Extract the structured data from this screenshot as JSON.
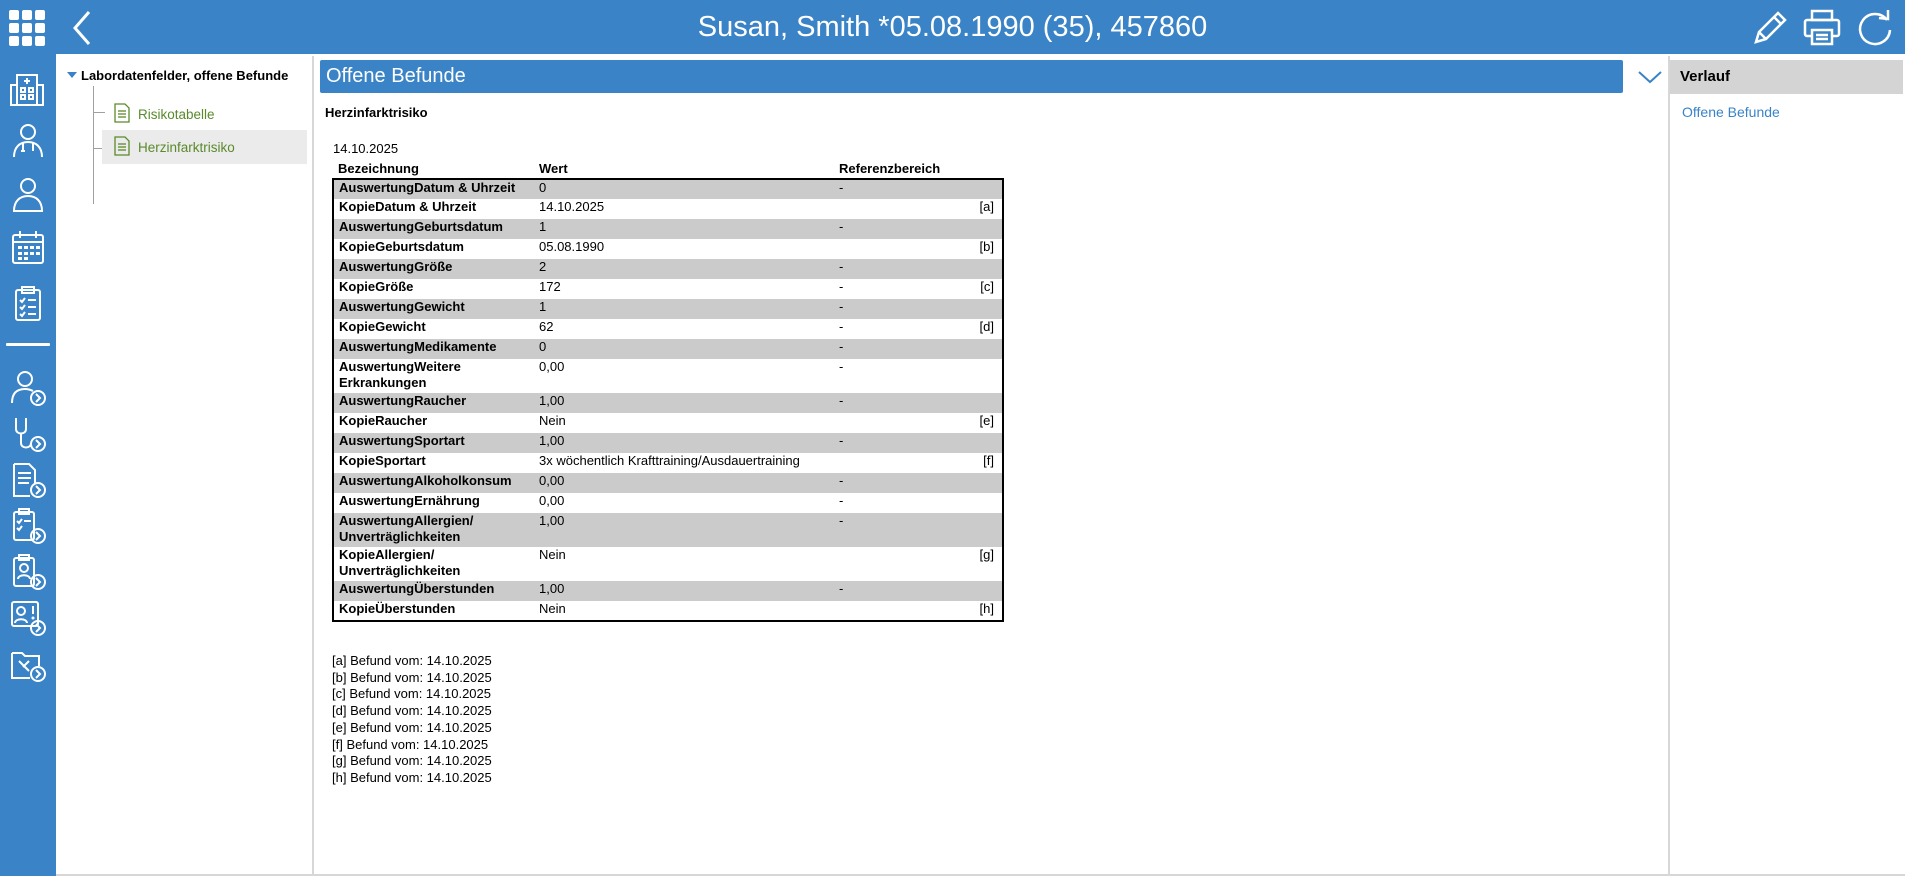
{
  "header": {
    "title": "Susan, Smith *05.08.1990 (35), 457860"
  },
  "icons": {
    "apps": "grid-icon",
    "back": "chevron-left-icon",
    "edit": "pencil-icon",
    "print": "printer-icon",
    "refresh": "refresh-icon"
  },
  "tree": {
    "root_label": "Labordatenfelder, offene Befunde",
    "items": [
      {
        "label": "Risikotabelle"
      },
      {
        "label": "Herzinfarktrisiko"
      }
    ]
  },
  "main": {
    "section_title": "Offene Befunde",
    "report_title": "Herzinfarktrisiko",
    "date": "14.10.2025",
    "columns": [
      "Bezeichnung",
      "Wert",
      "Referenzbereich"
    ],
    "rows": [
      {
        "name": "AuswertungDatum & Uhrzeit",
        "value": "0",
        "ref": "-",
        "note": ""
      },
      {
        "name": "KopieDatum & Uhrzeit",
        "value": "14.10.2025",
        "ref": "",
        "note": "[a]"
      },
      {
        "name": "AuswertungGeburtsdatum",
        "value": "1",
        "ref": "-",
        "note": ""
      },
      {
        "name": "KopieGeburtsdatum",
        "value": "05.08.1990",
        "ref": "",
        "note": "[b]"
      },
      {
        "name": "AuswertungGröße",
        "value": "2",
        "ref": "-",
        "note": ""
      },
      {
        "name": "KopieGröße",
        "value": "172",
        "ref": "-",
        "note": "[c]"
      },
      {
        "name": "AuswertungGewicht",
        "value": "1",
        "ref": "-",
        "note": ""
      },
      {
        "name": "KopieGewicht",
        "value": "62",
        "ref": "-",
        "note": "[d]"
      },
      {
        "name": "AuswertungMedikamente",
        "value": "0",
        "ref": "-",
        "note": ""
      },
      {
        "name": "AuswertungWeitere Erkrankungen",
        "value": "0,00",
        "ref": "-",
        "note": ""
      },
      {
        "name": "AuswertungRaucher",
        "value": "1,00",
        "ref": "-",
        "note": ""
      },
      {
        "name": "KopieRaucher",
        "value": "Nein",
        "ref": "",
        "note": "[e]"
      },
      {
        "name": "AuswertungSportart",
        "value": "1,00",
        "ref": "-",
        "note": ""
      },
      {
        "name": "KopieSportart",
        "value": "3x wöchentlich Krafttraining/Ausdauertraining",
        "ref": "",
        "note": "[f]"
      },
      {
        "name": "AuswertungAlkoholkonsum",
        "value": "0,00",
        "ref": "-",
        "note": ""
      },
      {
        "name": "AuswertungErnährung",
        "value": "0,00",
        "ref": "-",
        "note": ""
      },
      {
        "name": "AuswertungAllergien/ Unverträglichkeiten",
        "value": "1,00",
        "ref": "-",
        "note": ""
      },
      {
        "name": "KopieAllergien/ Unverträglichkeiten",
        "value": "Nein",
        "ref": "",
        "note": "[g]"
      },
      {
        "name": "AuswertungÜberstunden",
        "value": "1,00",
        "ref": "-",
        "note": ""
      },
      {
        "name": "KopieÜberstunden",
        "value": "Nein",
        "ref": "",
        "note": "[h]"
      }
    ],
    "footnotes": [
      "[a] Befund vom: 14.10.2025",
      "[b] Befund vom: 14.10.2025",
      "[c] Befund vom: 14.10.2025",
      "[d] Befund vom: 14.10.2025",
      "[e] Befund vom: 14.10.2025",
      "[f] Befund vom: 14.10.2025",
      "[g] Befund vom: 14.10.2025",
      "[h] Befund vom: 14.10.2025"
    ]
  },
  "right_panel": {
    "title": "Verlauf",
    "link": "Offene Befunde"
  },
  "colors": {
    "primary": "#3a83c6",
    "row_shaded": "#cbcbcb",
    "tree_text": "#5a8a2b"
  }
}
